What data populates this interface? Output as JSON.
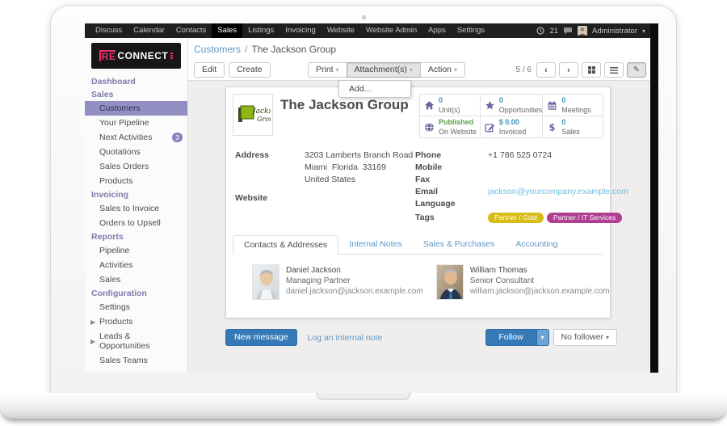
{
  "navbar": {
    "items": [
      "Discuss",
      "Calendar",
      "Contacts",
      "Sales",
      "Listings",
      "Invoicing",
      "Website",
      "Website Admin",
      "Apps",
      "Settings"
    ],
    "active_item": "Sales",
    "activity_count": "21",
    "user_name": "Administrator"
  },
  "sidebar": {
    "logo_accent": "RE",
    "logo_rest": "CONNECT",
    "sections": [
      {
        "header": "Dashboard",
        "items": []
      },
      {
        "header": "Sales",
        "items": [
          "Customers",
          "Your Pipeline",
          "Next Activities",
          "Quotations",
          "Sales Orders",
          "Products"
        ],
        "badge": "3"
      },
      {
        "header": "Invoicing",
        "items": [
          "Sales to Invoice",
          "Orders to Upsell"
        ]
      },
      {
        "header": "Reports",
        "items": [
          "Pipeline",
          "Activities",
          "Sales"
        ]
      },
      {
        "header": "Configuration",
        "items": [
          "Settings",
          "Products",
          "Leads & Opportunities",
          "Sales Teams"
        ]
      }
    ]
  },
  "breadcrumb": {
    "parent": "Customers",
    "sep": "/",
    "current": "The Jackson Group"
  },
  "control_bar": {
    "edit": "Edit",
    "create": "Create",
    "print": "Print",
    "attachments": "Attachment(s)",
    "action": "Action",
    "dropdown_add": "Add...",
    "pager": "5 / 6"
  },
  "form": {
    "title": "The Jackson Group",
    "logo_line1": "Jackson",
    "logo_line2": "Group",
    "stat_buttons": [
      {
        "icon": "home-icon",
        "value": "0",
        "label": "Unit(s)"
      },
      {
        "icon": "star-icon",
        "value": "0",
        "label": "Opportunities"
      },
      {
        "icon": "calendar-icon",
        "value": "0",
        "label": "Meetings"
      },
      {
        "icon": "globe-icon",
        "value": "Published",
        "label": "On Website"
      },
      {
        "icon": "edit-square-icon",
        "value": "$ 0.00",
        "label": "Invoiced"
      },
      {
        "icon": "dollar-icon",
        "value": "0",
        "label": "Sales"
      }
    ],
    "address_label": "Address",
    "address_lines": [
      "3203 Lamberts Branch Road",
      "Miami  Florida  33169",
      "United States"
    ],
    "website_label": "Website",
    "right_fields": [
      {
        "label": "Phone",
        "value": "+1 786 525 0724"
      },
      {
        "label": "Mobile",
        "value": ""
      },
      {
        "label": "Fax",
        "value": ""
      },
      {
        "label": "Email",
        "value": "jackson@yourcompany.example.com"
      },
      {
        "label": "Language",
        "value": ""
      },
      {
        "label": "Tags"
      }
    ],
    "tags": [
      {
        "text": "Partner / Gold",
        "color": "#d8bd14"
      },
      {
        "text": "Partner / IT Services",
        "color": "#b03f92"
      }
    ],
    "tabs": [
      "Contacts & Addresses",
      "Internal Notes",
      "Sales & Purchases",
      "Accounting"
    ],
    "active_tab": "Contacts & Addresses",
    "contacts": [
      {
        "name": "Daniel Jackson",
        "role": "Managing Partner",
        "email": "daniel.jackson@jackson.example.com"
      },
      {
        "name": "William Thomas",
        "role": "Senior Consultant",
        "email": "william.jackson@jackson.example.com"
      }
    ]
  },
  "chatter": {
    "new_message": "New message",
    "log_note": "Log an internal note",
    "follow": "Follow",
    "followers": "No follower"
  },
  "colors": {
    "accent_purple": "#7c7bad",
    "selected_purple": "#918fc3",
    "link_blue": "#5f97c6",
    "stat_value_blue": "#3f94c5",
    "published_green": "#55a245",
    "tag_gold": "#d8bd14",
    "tag_magenta": "#b03f92",
    "primary_button_blue": "#357ab7",
    "logo_pink": "#e5326e",
    "topbar_black": "#1f1f1f"
  }
}
